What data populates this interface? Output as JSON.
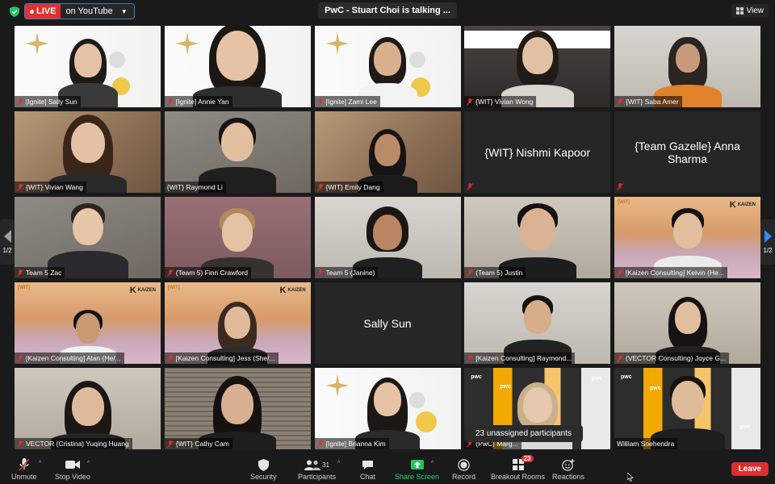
{
  "top": {
    "live_label": "LIVE",
    "live_dest": "on YouTube",
    "talking": "PwC - Stuart Choi is talking ...",
    "view_label": "View"
  },
  "tiles": [
    {
      "name": "[Ignite] Sally Sun",
      "bg": "ignite"
    },
    {
      "name": "[Ignite] Annie Yan",
      "bg": "ignite"
    },
    {
      "name": "[Ignite] Zami Lee",
      "bg": "ignite"
    },
    {
      "name": "{WIT} Vivian Wong",
      "bg": "banner"
    },
    {
      "name": "{WIT} Saba Amer",
      "bg": "office"
    },
    {
      "name": "{WIT} Vivian Wang",
      "bg": "warm"
    },
    {
      "name": "{WIT} Raymond Li",
      "bg": "room"
    },
    {
      "name": "{WIT} Emily Dang",
      "bg": "warm"
    },
    {
      "name": "{WIT} Nishmi Kapoor",
      "bg": "none"
    },
    {
      "name": "{Team Gazelle} Anna Sharma",
      "bg": "none"
    },
    {
      "name": "Team 5 Zac",
      "bg": "room"
    },
    {
      "name": "(Team 5) Finn Crawford",
      "bg": "pink"
    },
    {
      "name": "Team 5 (Janine)",
      "bg": "office"
    },
    {
      "name": "(Team 5) Justin",
      "bg": "wall"
    },
    {
      "name": "[Kaizen Consulting] Kelvin (He...",
      "bg": "desert"
    },
    {
      "name": "[Kaizen Consulting] Alan (He/...",
      "bg": "desert"
    },
    {
      "name": "[Kaizen Consulting] Jess (She/...",
      "bg": "desert"
    },
    {
      "name": "Sally Sun",
      "bg": "none"
    },
    {
      "name": "[Kaizen Consulting] Raymond...",
      "bg": "office"
    },
    {
      "name": "(VECTOR Consulting) Joyce G...",
      "bg": "wall"
    },
    {
      "name": "VECTOR (Cristina) Yuqing Huang",
      "bg": "wall"
    },
    {
      "name": "{WIT} Cathy Cam",
      "bg": "blinds"
    },
    {
      "name": "[Ignite] Brianna Kim",
      "bg": "ignite"
    },
    {
      "name": "(PwC) Marg...",
      "bg": "pwc"
    },
    {
      "name": "William Soehendra",
      "bg": "pwc"
    }
  ],
  "pagination": {
    "left": "1/2",
    "right": "1/2"
  },
  "toast": "23 unassigned participants",
  "toolbar": {
    "unmute": "Unmute",
    "stop_video": "Stop Video",
    "security": "Security",
    "participants": "Participants",
    "participants_count": "31",
    "chat": "Chat",
    "share_screen": "Share Screen",
    "record": "Record",
    "breakout_rooms": "Breakout Rooms",
    "breakout_badge": "23",
    "reactions": "Reactions",
    "leave": "Leave"
  },
  "colors": {
    "live_red": "#e0302f",
    "share_green": "#22c55e",
    "arrow_blue": "#2d8cff",
    "leave_red": "#d9302f",
    "pwc_orange": "#f2a900"
  }
}
